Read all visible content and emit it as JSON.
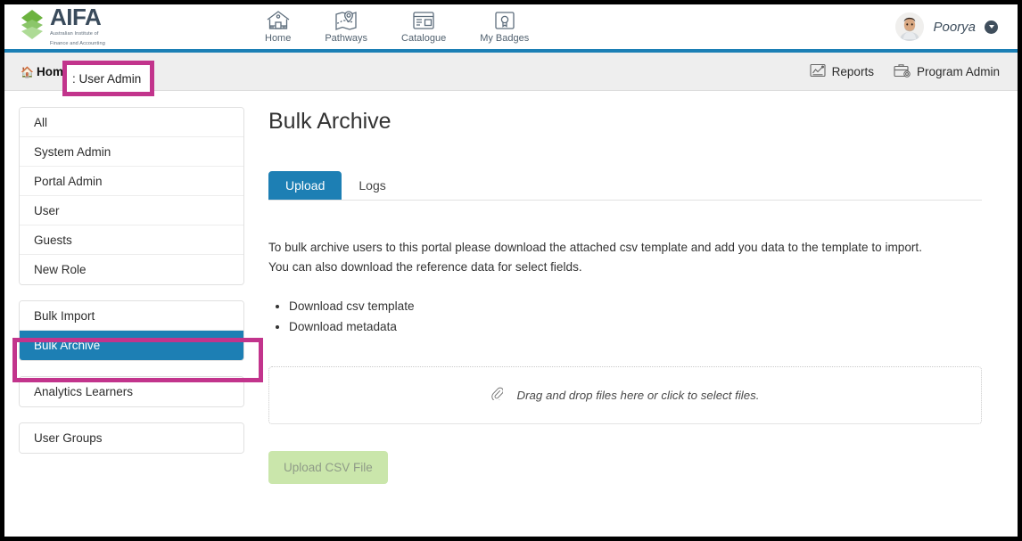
{
  "brand": {
    "title": "AIFA",
    "tagline_line1": "Australian Institute of",
    "tagline_line2": "Finance and Accounting",
    "logo_icon": "green-chevron-stack-icon",
    "logo_color": "#7ab648"
  },
  "header": {
    "nav": [
      {
        "label": "Home",
        "icon": "house-icon"
      },
      {
        "label": "Pathways",
        "icon": "map-pin-icon"
      },
      {
        "label": "Catalogue",
        "icon": "browser-window-icon"
      },
      {
        "label": "My Badges",
        "icon": "certificate-icon"
      }
    ],
    "user": {
      "name": "Poorya",
      "avatar_icon": "user-avatar-photo",
      "caret_icon": "chevron-down-icon"
    },
    "band_color": "#1b7fb5"
  },
  "breadcrumb": {
    "home_icon": "home-icon",
    "home_label": "Home",
    "separator": ":",
    "current": "User Admin",
    "highlight_color": "#c2348c",
    "right_links": [
      {
        "label": "Reports",
        "icon": "chart-report-icon"
      },
      {
        "label": "Program Admin",
        "icon": "briefcase-gear-icon"
      }
    ]
  },
  "sidebar": {
    "roles_card": [
      {
        "label": "All",
        "active": false
      },
      {
        "label": "System Admin",
        "active": false
      },
      {
        "label": "Portal Admin",
        "active": false
      },
      {
        "label": "User",
        "active": false
      },
      {
        "label": "Guests",
        "active": false
      },
      {
        "label": "New Role",
        "active": false
      }
    ],
    "bulk_card": [
      {
        "label": "Bulk Import",
        "active": false
      },
      {
        "label": "Bulk Archive",
        "active": true
      }
    ],
    "analytics_card": [
      {
        "label": "Analytics Learners",
        "active": false
      }
    ],
    "groups_card": [
      {
        "label": "User Groups",
        "active": false
      }
    ],
    "active_color": "#1d7fb4",
    "highlight_color": "#c2348c"
  },
  "main": {
    "title": "Bulk Archive",
    "tabs": [
      {
        "label": "Upload",
        "active": true
      },
      {
        "label": "Logs",
        "active": false
      }
    ],
    "intro_line1": "To bulk archive users to this portal please download the attached csv template and add you data to the template to import.",
    "intro_line2": "You can also download the reference data for select fields.",
    "downloads": [
      "Download csv template",
      "Download metadata"
    ],
    "dropzone": {
      "icon": "paperclip-icon",
      "text": "Drag and drop files here or click to select files."
    },
    "upload_button": {
      "label": "Upload CSV File",
      "bg_color": "#cae6ab",
      "text_color": "#8f9b88"
    }
  }
}
